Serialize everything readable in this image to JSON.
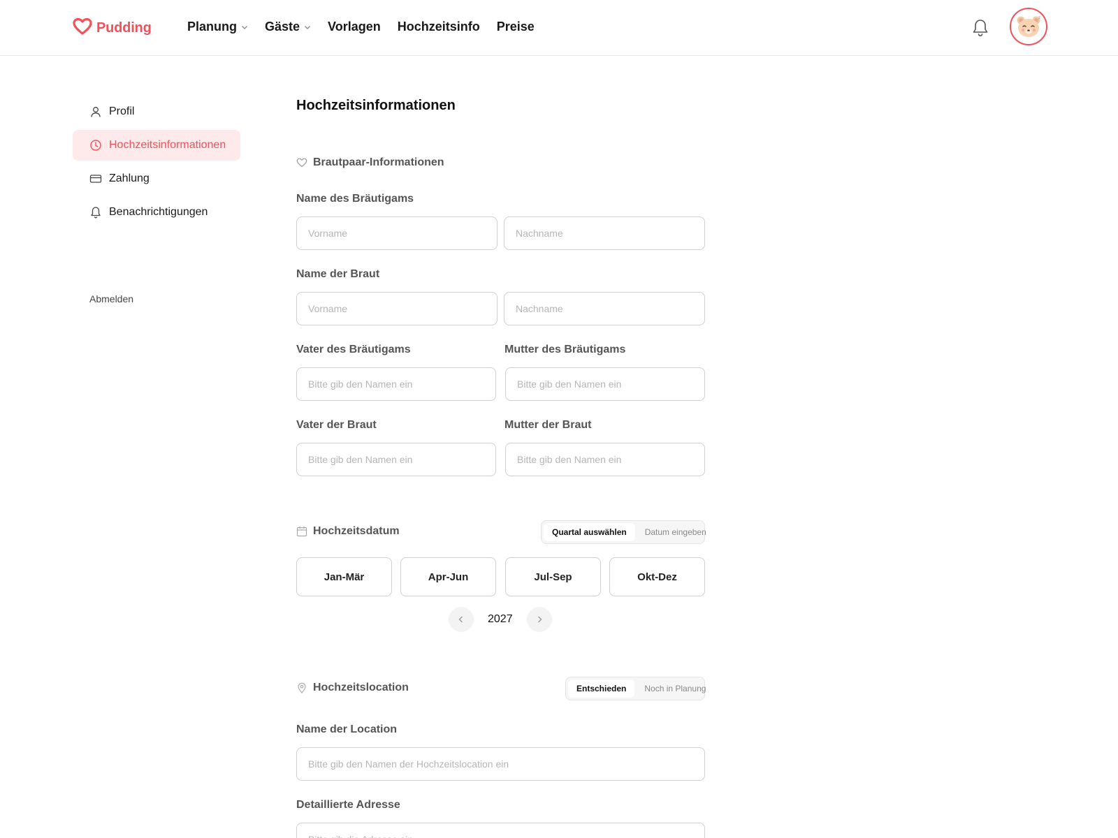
{
  "brand": {
    "name": "Pudding",
    "color": "#f0525a",
    "icon": "heart-icon"
  },
  "nav": {
    "items": [
      {
        "label": "Planung",
        "dropdown": true
      },
      {
        "label": "Gäste",
        "dropdown": true
      },
      {
        "label": "Vorlagen",
        "dropdown": false
      },
      {
        "label": "Hochzeitsinfo",
        "dropdown": false
      },
      {
        "label": "Preise",
        "dropdown": false
      }
    ],
    "notification_icon": "bell-icon",
    "avatar_icon": "bear-avatar-icon"
  },
  "sidebar": {
    "items": [
      {
        "label": "Profil",
        "icon": "user-icon",
        "active": false
      },
      {
        "label": "Hochzeitsinformationen",
        "icon": "clock-icon",
        "active": true
      },
      {
        "label": "Zahlung",
        "icon": "card-icon",
        "active": false
      },
      {
        "label": "Benachrichtigungen",
        "icon": "bell-icon",
        "active": false
      }
    ],
    "logout": "Abmelden"
  },
  "main": {
    "title": "Hochzeitsinformationen",
    "couple": {
      "heading": "Brautpaar-Informationen",
      "groom_label": "Name des Bräutigams",
      "groom_first_placeholder": "Vorname",
      "groom_last_placeholder": "Nachname",
      "bride_label": "Name der Braut",
      "bride_first_placeholder": "Vorname",
      "bride_last_placeholder": "Nachname",
      "groom_father_label": "Vater des Bräutigams",
      "groom_mother_label": "Mutter des Bräutigams",
      "bride_father_label": "Vater der Braut",
      "bride_mother_label": "Mutter der Braut",
      "name_placeholder": "Bitte gib den Namen ein"
    },
    "date": {
      "heading": "Hochzeitsdatum",
      "toggle": {
        "selected": "Quartal auswählen",
        "other": "Datum eingeben"
      },
      "quarters": [
        "Jan-Mär",
        "Apr-Jun",
        "Jul-Sep",
        "Okt-Dez"
      ],
      "year": "2027"
    },
    "location": {
      "heading": "Hochzeitslocation",
      "toggle": {
        "selected": "Entschieden",
        "other": "Noch in Planung"
      },
      "venue_label": "Name der Location",
      "venue_placeholder": "Bitte gib den Namen der Hochzeitslocation ein",
      "address_label": "Detaillierte Adresse",
      "address_placeholder": "Bitte gib die Adresse ein"
    }
  }
}
